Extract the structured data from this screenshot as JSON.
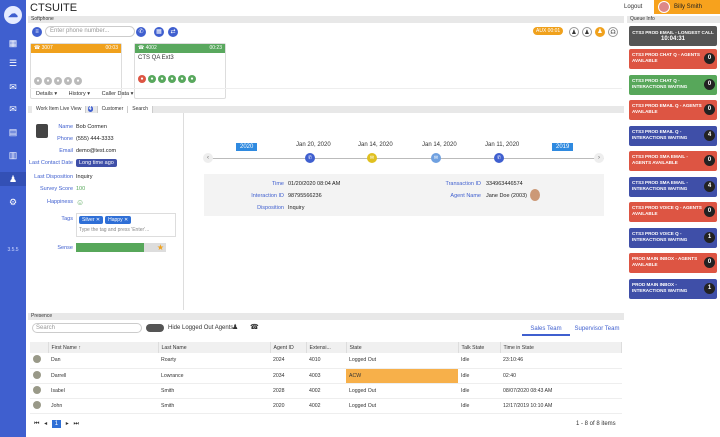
{
  "app": {
    "title": "CTSUITE",
    "logout": "Logout",
    "user": "Billy Smith",
    "version": "3.5.5"
  },
  "softphone": {
    "panel": "Softphone",
    "dial_placeholder": "Enter phone number...",
    "aux_badge": "AUX 00:01",
    "calls": [
      {
        "ext": "3007",
        "time": "00:03",
        "color": "#f0a11c",
        "name": ""
      },
      {
        "ext": "4002",
        "time": "00:23",
        "color": "#59a85e",
        "name": "CTS QA Ext3"
      }
    ],
    "tabs": [
      "Details",
      "History",
      "Caller Data"
    ]
  },
  "workitem": {
    "tabs": [
      "Work Item Live View",
      "Customer",
      "Search"
    ],
    "badge": "4",
    "fields": [
      {
        "label": "Name",
        "value": "Bob Cormen"
      },
      {
        "label": "Phone",
        "value": "(555) 444-3333"
      },
      {
        "label": "Email",
        "value": "demo@test.com"
      },
      {
        "label": "Last Contact Date",
        "value": "Long time ago"
      },
      {
        "label": "Last Disposition",
        "value": "Inquiry"
      },
      {
        "label": "Survey Score",
        "value": "100"
      },
      {
        "label": "Happiness",
        "value": ""
      },
      {
        "label": "Tags",
        "value": ""
      },
      {
        "label": "Sense",
        "value": ""
      }
    ],
    "tags": [
      "Silver",
      "Happy"
    ],
    "tag_placeholder": "Type the tag and press 'Enter'...",
    "timeline": {
      "start": "2020",
      "end": "2019",
      "dates": [
        "Jan 20, 2020",
        "Jan 14, 2020",
        "Jan 14, 2020",
        "Jan 11, 2020"
      ]
    },
    "detail": {
      "time_label": "Time",
      "time": "01/20/2020 08:04 AM",
      "iid_label": "Interaction ID",
      "iid": "98795566236",
      "disp_label": "Disposition",
      "disp": "Inquiry",
      "tid_label": "Transaction ID",
      "tid": "334963446574",
      "agent_label": "Agent Name",
      "agent": "Jane Doe (2003)"
    }
  },
  "queue": {
    "panel": "Queue Info",
    "longest": {
      "title": "CTS3 PROD EMAIL - LONGEST CALL",
      "time": "10:04:31"
    },
    "items": [
      {
        "t": "CTS3 PROD CHAT Q - AGENTS AVAILABLE",
        "n": "0",
        "c": "red"
      },
      {
        "t": "CTS3 PROD CHAT Q - INTERACTIONS WAITING",
        "n": "0",
        "c": "green"
      },
      {
        "t": "CTS3 PROD EMAIL Q - AGENTS AVAILABLE",
        "n": "0",
        "c": "red"
      },
      {
        "t": "CTS3 PROD EMAIL Q - INTERACTIONS WAITING",
        "n": "4",
        "c": "blue"
      },
      {
        "t": "CTS3 PROD SMA EMAIL - AGENTS AVAILABLE",
        "n": "0",
        "c": "red"
      },
      {
        "t": "CTS3 PROD SMA EMAIL - INTERACTIONS WAITING",
        "n": "4",
        "c": "blue"
      },
      {
        "t": "CTS3 PROD VOICE Q - AGENTS AVAILABLE",
        "n": "0",
        "c": "red"
      },
      {
        "t": "CTS3 PROD VOICE Q - INTERACTIONS WAITING",
        "n": "1",
        "c": "blue"
      },
      {
        "t": "PROD MAIN INBOX - AGENTS AVAILABLE",
        "n": "0",
        "c": "red"
      },
      {
        "t": "PROD MAIN INBOX - INTERACTIONS WAITING",
        "n": "1",
        "c": "blue"
      }
    ]
  },
  "presence": {
    "panel": "Presence",
    "search": "Search",
    "toggle": "Hide Logged Out Agents",
    "teams": [
      "Sales Team",
      "Supervisor Team"
    ],
    "columns": [
      "First Name",
      "Last Name",
      "Agent ID",
      "Extensi...",
      "State",
      "Talk State",
      "Time in State"
    ],
    "rows": [
      [
        "Dan",
        "Roarty",
        "2024",
        "4010",
        "Logged Out",
        "Idle",
        "23:10:46"
      ],
      [
        "Darrell",
        "Lowrance",
        "2034",
        "4003",
        "ACW",
        "Idle",
        "02:40"
      ],
      [
        "Isabel",
        "Smith",
        "2028",
        "4002",
        "Logged Out",
        "Idle",
        "08/07/2020 08:43 AM"
      ],
      [
        "John",
        "Smith",
        "2020",
        "4002",
        "Logged Out",
        "Idle",
        "12/17/2019 10:10 AM"
      ]
    ],
    "pager": "1",
    "count": "1 - 8 of 8 items"
  }
}
